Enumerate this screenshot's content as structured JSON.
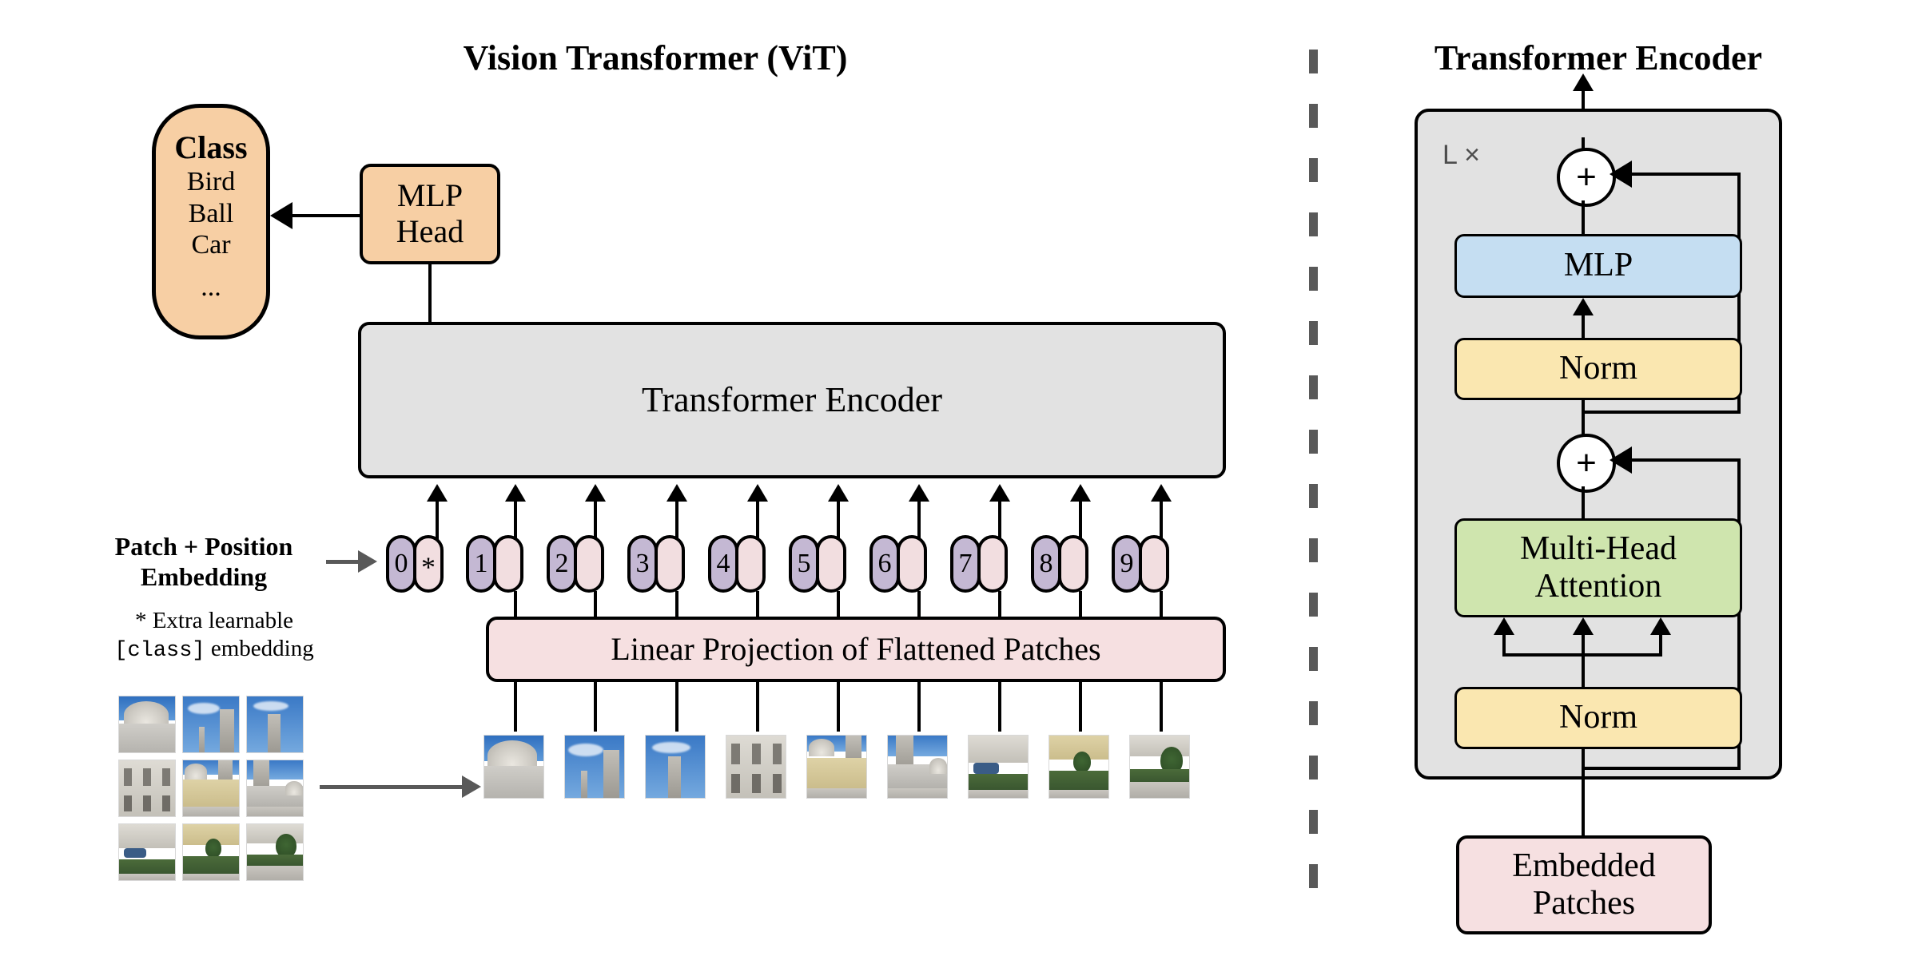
{
  "left_panel": {
    "title": "Vision Transformer (ViT)",
    "class_box": {
      "heading": "Class",
      "items": [
        "Bird",
        "Ball",
        "Car"
      ],
      "ellipsis": "..."
    },
    "mlp_head": {
      "line1": "MLP",
      "line2": "Head"
    },
    "transformer_encoder": "Transformer Encoder",
    "linear_projection": "Linear Projection of Flattened Patches",
    "annotations": {
      "embedding_label_line1": "Patch + Position",
      "embedding_label_line2": "Embedding",
      "footnote_line1_marker": "*",
      "footnote_line1_text": "Extra learnable",
      "footnote_line2_code": "[class]",
      "footnote_line2_text": "embedding"
    },
    "tokens": [
      {
        "position": "0",
        "patch": "*",
        "is_class_token": true
      },
      {
        "position": "1",
        "patch": "",
        "is_class_token": false
      },
      {
        "position": "2",
        "patch": "",
        "is_class_token": false
      },
      {
        "position": "3",
        "patch": "",
        "is_class_token": false
      },
      {
        "position": "4",
        "patch": "",
        "is_class_token": false
      },
      {
        "position": "5",
        "patch": "",
        "is_class_token": false
      },
      {
        "position": "6",
        "patch": "",
        "is_class_token": false
      },
      {
        "position": "7",
        "patch": "",
        "is_class_token": false
      },
      {
        "position": "8",
        "patch": "",
        "is_class_token": false
      },
      {
        "position": "9",
        "patch": "",
        "is_class_token": false
      }
    ],
    "source_image_grid": {
      "rows": 3,
      "cols": 3,
      "description": "photograph of a palace facade split into 9 square patches"
    },
    "patch_strip_count": 9
  },
  "right_panel": {
    "title": "Transformer Encoder",
    "repeat_label": "L ×",
    "blocks": {
      "mlp": "MLP",
      "norm_top": "Norm",
      "attention_line1": "Multi-Head",
      "attention_line2": "Attention",
      "norm_bottom": "Norm",
      "embedded_patches_line1": "Embedded",
      "embedded_patches_line2": "Patches"
    },
    "residual_add_symbol": "+",
    "qkv_arrow_count": 3
  },
  "colors": {
    "orange": "#F7CFA4",
    "gray_box": "#E2E2E2",
    "pink": "#F6E0E1",
    "pill_position": "#C4B8D3",
    "pill_patch": "#F2DEE0",
    "mlp_blue": "#C5DEF2",
    "norm_yellow": "#FAE7B0",
    "attention_green": "#CFE5AE",
    "stroke": "#000000",
    "divider_gray": "#595959"
  }
}
